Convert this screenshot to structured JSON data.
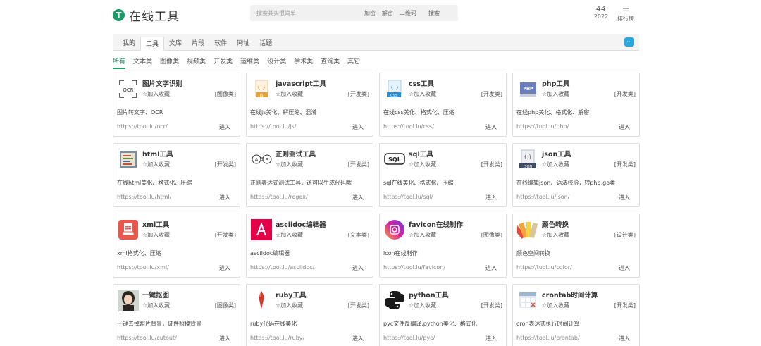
{
  "header": {
    "logo_mark": "T",
    "logo_text": "在线工具",
    "search_placeholder": "搜索其实很简单",
    "quick_links": [
      "加密",
      "解密",
      "二维码"
    ],
    "search_button": "搜索",
    "counter_number": "44",
    "counter_year": "2022",
    "rank_icon": "☰",
    "rank_label": "排行榜"
  },
  "categories": {
    "tabs": [
      "我的",
      "工具",
      "文库",
      "片段",
      "软件",
      "网址",
      "话题"
    ],
    "active_index": 1
  },
  "subtabs": {
    "items": [
      "所有",
      "文本类",
      "图像类",
      "视频类",
      "开发类",
      "运维类",
      "设计类",
      "学术类",
      "查询类",
      "其它"
    ],
    "active_index": 0
  },
  "common": {
    "fav_label": "☆加入收藏",
    "enter_label": "进入"
  },
  "tools": [
    {
      "name": "图片文字识别",
      "tag": "[图像类]",
      "desc": "图片转文字、OCR",
      "url": "https://tool.lu/ocr/",
      "icon": "ocr-icon",
      "icon_text": "OCR"
    },
    {
      "name": "javascript工具",
      "tag": "[开发类]",
      "desc": "在线js美化、解压缩、混淆",
      "url": "https://tool.lu/js/",
      "icon": "js-file-icon",
      "icon_text": "JS"
    },
    {
      "name": "css工具",
      "tag": "[开发类]",
      "desc": "在线css美化、格式化、压缩",
      "url": "https://tool.lu/css/",
      "icon": "css-file-icon",
      "icon_text": "CSS"
    },
    {
      "name": "php工具",
      "tag": "[开发类]",
      "desc": "在线php美化、格式化、解密",
      "url": "https://tool.lu/php/",
      "icon": "php-file-icon",
      "icon_text": "PHP"
    },
    {
      "name": "html工具",
      "tag": "[开发类]",
      "desc": "在线html美化、格式化、压缩",
      "url": "https://tool.lu/html/",
      "icon": "html-file-icon",
      "icon_text": ""
    },
    {
      "name": "正则测试工具",
      "tag": "[开发类]",
      "desc": "正则表达式测试工具，还可以生成代码哦",
      "url": "https://tool.lu/regex/",
      "icon": "regex-icon",
      "icon_text": "A⇌"
    },
    {
      "name": "sql工具",
      "tag": "[开发类]",
      "desc": "sql在线美化、格式化、压缩",
      "url": "https://tool.lu/sql/",
      "icon": "sql-icon",
      "icon_text": "SQL"
    },
    {
      "name": "json工具",
      "tag": "[开发类]",
      "desc": "在线编辑json、语法校验，转php,go类",
      "url": "https://tool.lu/json/",
      "icon": "json-file-icon",
      "icon_text": "JSON"
    },
    {
      "name": "xml工具",
      "tag": "[开发类]",
      "desc": "xml格式化、压缩",
      "url": "https://tool.lu/xml/",
      "icon": "xml-file-icon",
      "icon_text": "XML"
    },
    {
      "name": "asciidoc编辑器",
      "tag": "[文本类]",
      "desc": "asciidoc编辑器",
      "url": "https://tool.lu/asciidoc/",
      "icon": "asciidoc-icon",
      "icon_text": "A"
    },
    {
      "name": "favicon在线制作",
      "tag": "[图像类]",
      "desc": "icon在线制作",
      "url": "https://tool.lu/favicon/",
      "icon": "favicon-icon",
      "icon_text": ""
    },
    {
      "name": "颜色转换",
      "tag": "[设计类]",
      "desc": "颜色空间转换",
      "url": "https://tool.lu/color/",
      "icon": "color-palette-icon",
      "icon_text": ""
    },
    {
      "name": "一键抠图",
      "tag": "[图像类]",
      "desc": "一键去掉照片背景，证件照换背景",
      "url": "https://tool.lu/cutout/",
      "icon": "portrait-icon",
      "icon_text": ""
    },
    {
      "name": "ruby工具",
      "tag": "[开发类]",
      "desc": "ruby代码在线美化",
      "url": "https://tool.lu/ruby/",
      "icon": "ruby-icon",
      "icon_text": ""
    },
    {
      "name": "python工具",
      "tag": "[开发类]",
      "desc": "pyc文件反编译,python美化、格式化",
      "url": "https://tool.lu/pyc/",
      "icon": "python-icon",
      "icon_text": ""
    },
    {
      "name": "crontab时间计算",
      "tag": "[开发类]",
      "desc": "cron表达式执行时间计算",
      "url": "https://tool.lu/crontab/",
      "icon": "crontab-icon",
      "icon_text": ""
    }
  ],
  "colors": {
    "brand": "#1a9c68",
    "chat": "#29a8e0"
  }
}
